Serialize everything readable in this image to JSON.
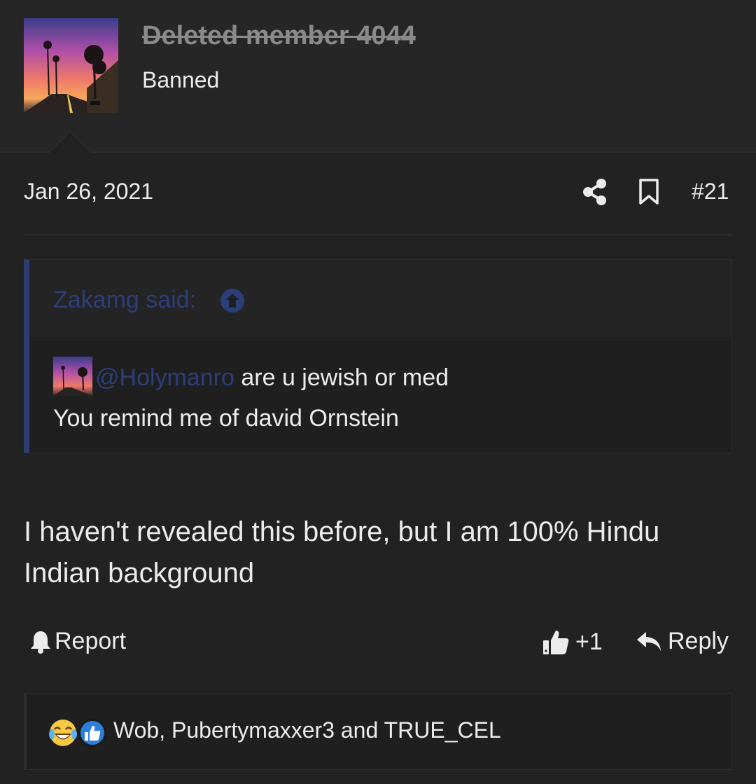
{
  "post": {
    "author": {
      "name": "Deleted member 4044",
      "title": "Banned"
    },
    "date": "Jan 26, 2021",
    "number": "#21",
    "quote": {
      "author": "Zakamg said:",
      "mention": "@Holymanro",
      "line1_rest": " are u jewish or med",
      "line2": "You remind me of david Ornstein"
    },
    "message": "I haven't revealed this before, but I am 100% Hindu Indian background"
  },
  "actions": {
    "report": "Report",
    "like": "+1",
    "reply": "Reply"
  },
  "reactions": {
    "users": "Wob, Pubertymaxxer3 and TRUE_CEL",
    "icons": [
      "crying-laughing-emoji-icon",
      "thumbs-up-reaction-icon"
    ]
  },
  "colors": {
    "background": "#222222",
    "header": "#262626",
    "link": "#2c3e7a",
    "quote_border": "#2c3d73",
    "text": "#ececec",
    "muted": "#8a8a8a"
  }
}
